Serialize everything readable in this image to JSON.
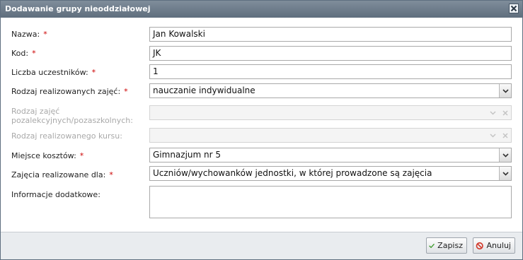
{
  "dialog": {
    "title": "Dodawanie grupy nieoddziałowej",
    "close_icon": "close-icon"
  },
  "form": {
    "nazwa": {
      "label": "Nazwa:",
      "required": "*",
      "value": "Jan Kowalski"
    },
    "kod": {
      "label": "Kod:",
      "required": "*",
      "value": "JK"
    },
    "liczba": {
      "label": "Liczba uczestników:",
      "required": "*",
      "value": "1"
    },
    "rodzaj_zajec": {
      "label": "Rodzaj realizowanych zajęć:",
      "required": "*",
      "value": "nauczanie indywidualne"
    },
    "rodzaj_pozalekcyjnych": {
      "label_line1": "Rodzaj zajęć",
      "label_line2": "pozalekcyjnych/pozaszkolnych:",
      "value": ""
    },
    "rodzaj_kursu": {
      "label": "Rodzaj realizowanego kursu:",
      "value": ""
    },
    "miejsce_kosztow": {
      "label": "Miejsce kosztów:",
      "required": "*",
      "value": "Gimnazjum nr 5"
    },
    "zajecia_dla": {
      "label": "Zajęcia realizowane dla:",
      "required": "*",
      "value": "Uczniów/wychowanków jednostki, w której prowadzone są  zajęcia"
    },
    "informacje": {
      "label": "Informacje dodatkowe:",
      "value": ""
    }
  },
  "footer": {
    "save_label": "Zapisz",
    "cancel_label": "Anuluj"
  },
  "colors": {
    "titlebar": "#6f7e8d",
    "required": "#cc0000",
    "save_check": "#3c9a2a",
    "cancel_icon": "#d23a2c"
  }
}
